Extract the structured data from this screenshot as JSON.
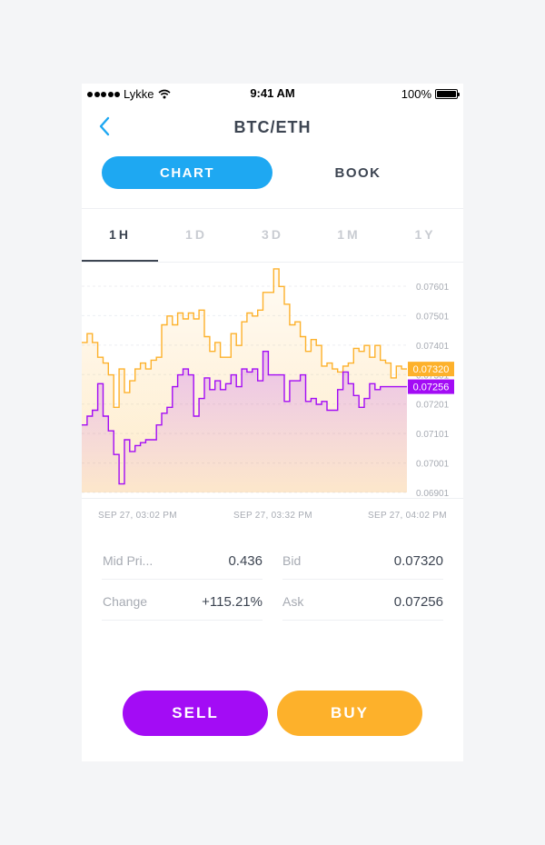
{
  "status_bar": {
    "carrier": "Lykke",
    "time": "9:41 AM",
    "battery": "100%"
  },
  "nav": {
    "title": "BTC/ETH"
  },
  "view_tabs": {
    "chart": "CHART",
    "book": "BOOK"
  },
  "timeframes": [
    "1H",
    "1D",
    "3D",
    "1M",
    "1Y"
  ],
  "active_timeframe": "1H",
  "colors": {
    "ask": "#fdb12b",
    "bid": "#a30cf5",
    "accent": "#1ea8f2",
    "text": "#3d4552",
    "muted": "#a7abb3"
  },
  "chart_data": {
    "type": "line",
    "step": true,
    "x_labels": [
      "SEP 27, 03:02 PM",
      "SEP 27, 03:32 PM",
      "SEP 27, 04:02 PM"
    ],
    "y_ticks": [
      "0.07601",
      "0.07501",
      "0.07401",
      "0.07301",
      "0.07201",
      "0.07101",
      "0.07001",
      "0.06901"
    ],
    "ylim": [
      0.06901,
      0.07601
    ],
    "series": [
      {
        "name": "Bid",
        "color": "#fdb12b",
        "last_label": "0.07320",
        "values": [
          0.0741,
          0.0744,
          0.0741,
          0.0736,
          0.0734,
          0.073,
          0.0719,
          0.0732,
          0.0724,
          0.0728,
          0.0732,
          0.0734,
          0.0732,
          0.0735,
          0.0736,
          0.0747,
          0.075,
          0.0747,
          0.0751,
          0.0749,
          0.0751,
          0.0749,
          0.0752,
          0.0743,
          0.0738,
          0.0741,
          0.0736,
          0.0736,
          0.0744,
          0.074,
          0.0748,
          0.0751,
          0.075,
          0.0752,
          0.0758,
          0.0758,
          0.0766,
          0.076,
          0.0754,
          0.0747,
          0.0748,
          0.0743,
          0.0738,
          0.0742,
          0.074,
          0.0733,
          0.0734,
          0.0732,
          0.0731,
          0.0733,
          0.0734,
          0.0739,
          0.0738,
          0.074,
          0.0736,
          0.074,
          0.0735,
          0.0734,
          0.0729,
          0.0733,
          0.0732
        ]
      },
      {
        "name": "Ask",
        "color": "#a30cf5",
        "last_label": "0.07256",
        "values": [
          0.0713,
          0.0716,
          0.0718,
          0.0727,
          0.0716,
          0.0711,
          0.0703,
          0.0693,
          0.0708,
          0.0704,
          0.0706,
          0.0707,
          0.0708,
          0.0708,
          0.0713,
          0.0717,
          0.0719,
          0.0726,
          0.073,
          0.0732,
          0.073,
          0.0716,
          0.0722,
          0.0729,
          0.0725,
          0.0728,
          0.0725,
          0.0727,
          0.073,
          0.0726,
          0.0732,
          0.0731,
          0.0732,
          0.0728,
          0.0738,
          0.073,
          0.073,
          0.073,
          0.0721,
          0.0728,
          0.0728,
          0.073,
          0.0721,
          0.0722,
          0.072,
          0.0721,
          0.0718,
          0.0718,
          0.0725,
          0.0731,
          0.0727,
          0.0723,
          0.0719,
          0.0722,
          0.0727,
          0.0725,
          0.0726,
          0.0726,
          0.0726,
          0.0726,
          0.0726
        ]
      }
    ]
  },
  "stats": {
    "mid_price_label": "Mid Pri...",
    "mid_price_value": "0.436",
    "bid_label": "Bid",
    "bid_value": "0.07320",
    "change_label": "Change",
    "change_value": "+115.21%",
    "ask_label": "Ask",
    "ask_value": "0.07256"
  },
  "actions": {
    "sell": "SELL",
    "buy": "BUY"
  }
}
